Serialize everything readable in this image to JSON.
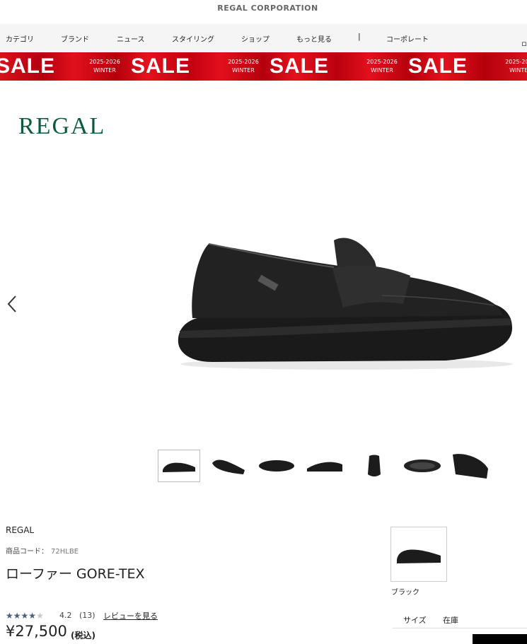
{
  "header": {
    "corporation": "REGAL CORPORATION"
  },
  "nav": {
    "items": [
      "カテゴリ",
      "ブランド",
      "ニュース",
      "スタイリング",
      "ショップ",
      "もっと見る"
    ],
    "separator": "|",
    "corporate": "コーポレート",
    "login_fragment": "ロ"
  },
  "banner": {
    "sale_text": "SALE",
    "season_year": "2025-2026",
    "season_name": "WINTER"
  },
  "brand_logo": "REGAL",
  "gallery": {
    "prev_icon": "chevron-left-icon",
    "thumbnail_count": 7,
    "selected_index": 0
  },
  "product": {
    "brand": "REGAL",
    "code_label": "商品コード：",
    "code": "72HLBE",
    "name": "ローファー GORE-TEX",
    "rating": "4.2",
    "rating_value": 4.2,
    "review_count": "(13)",
    "review_link": "レビューを見る",
    "price": "¥27,500",
    "tax_label": "(税込)"
  },
  "variants": {
    "color_label": "ブラック",
    "table_headers": {
      "size": "サイズ",
      "stock": "在庫"
    }
  },
  "colors": {
    "brand_green": "#0b5c3c",
    "sale_red": "#d7121c",
    "star": "#4a5d82"
  }
}
